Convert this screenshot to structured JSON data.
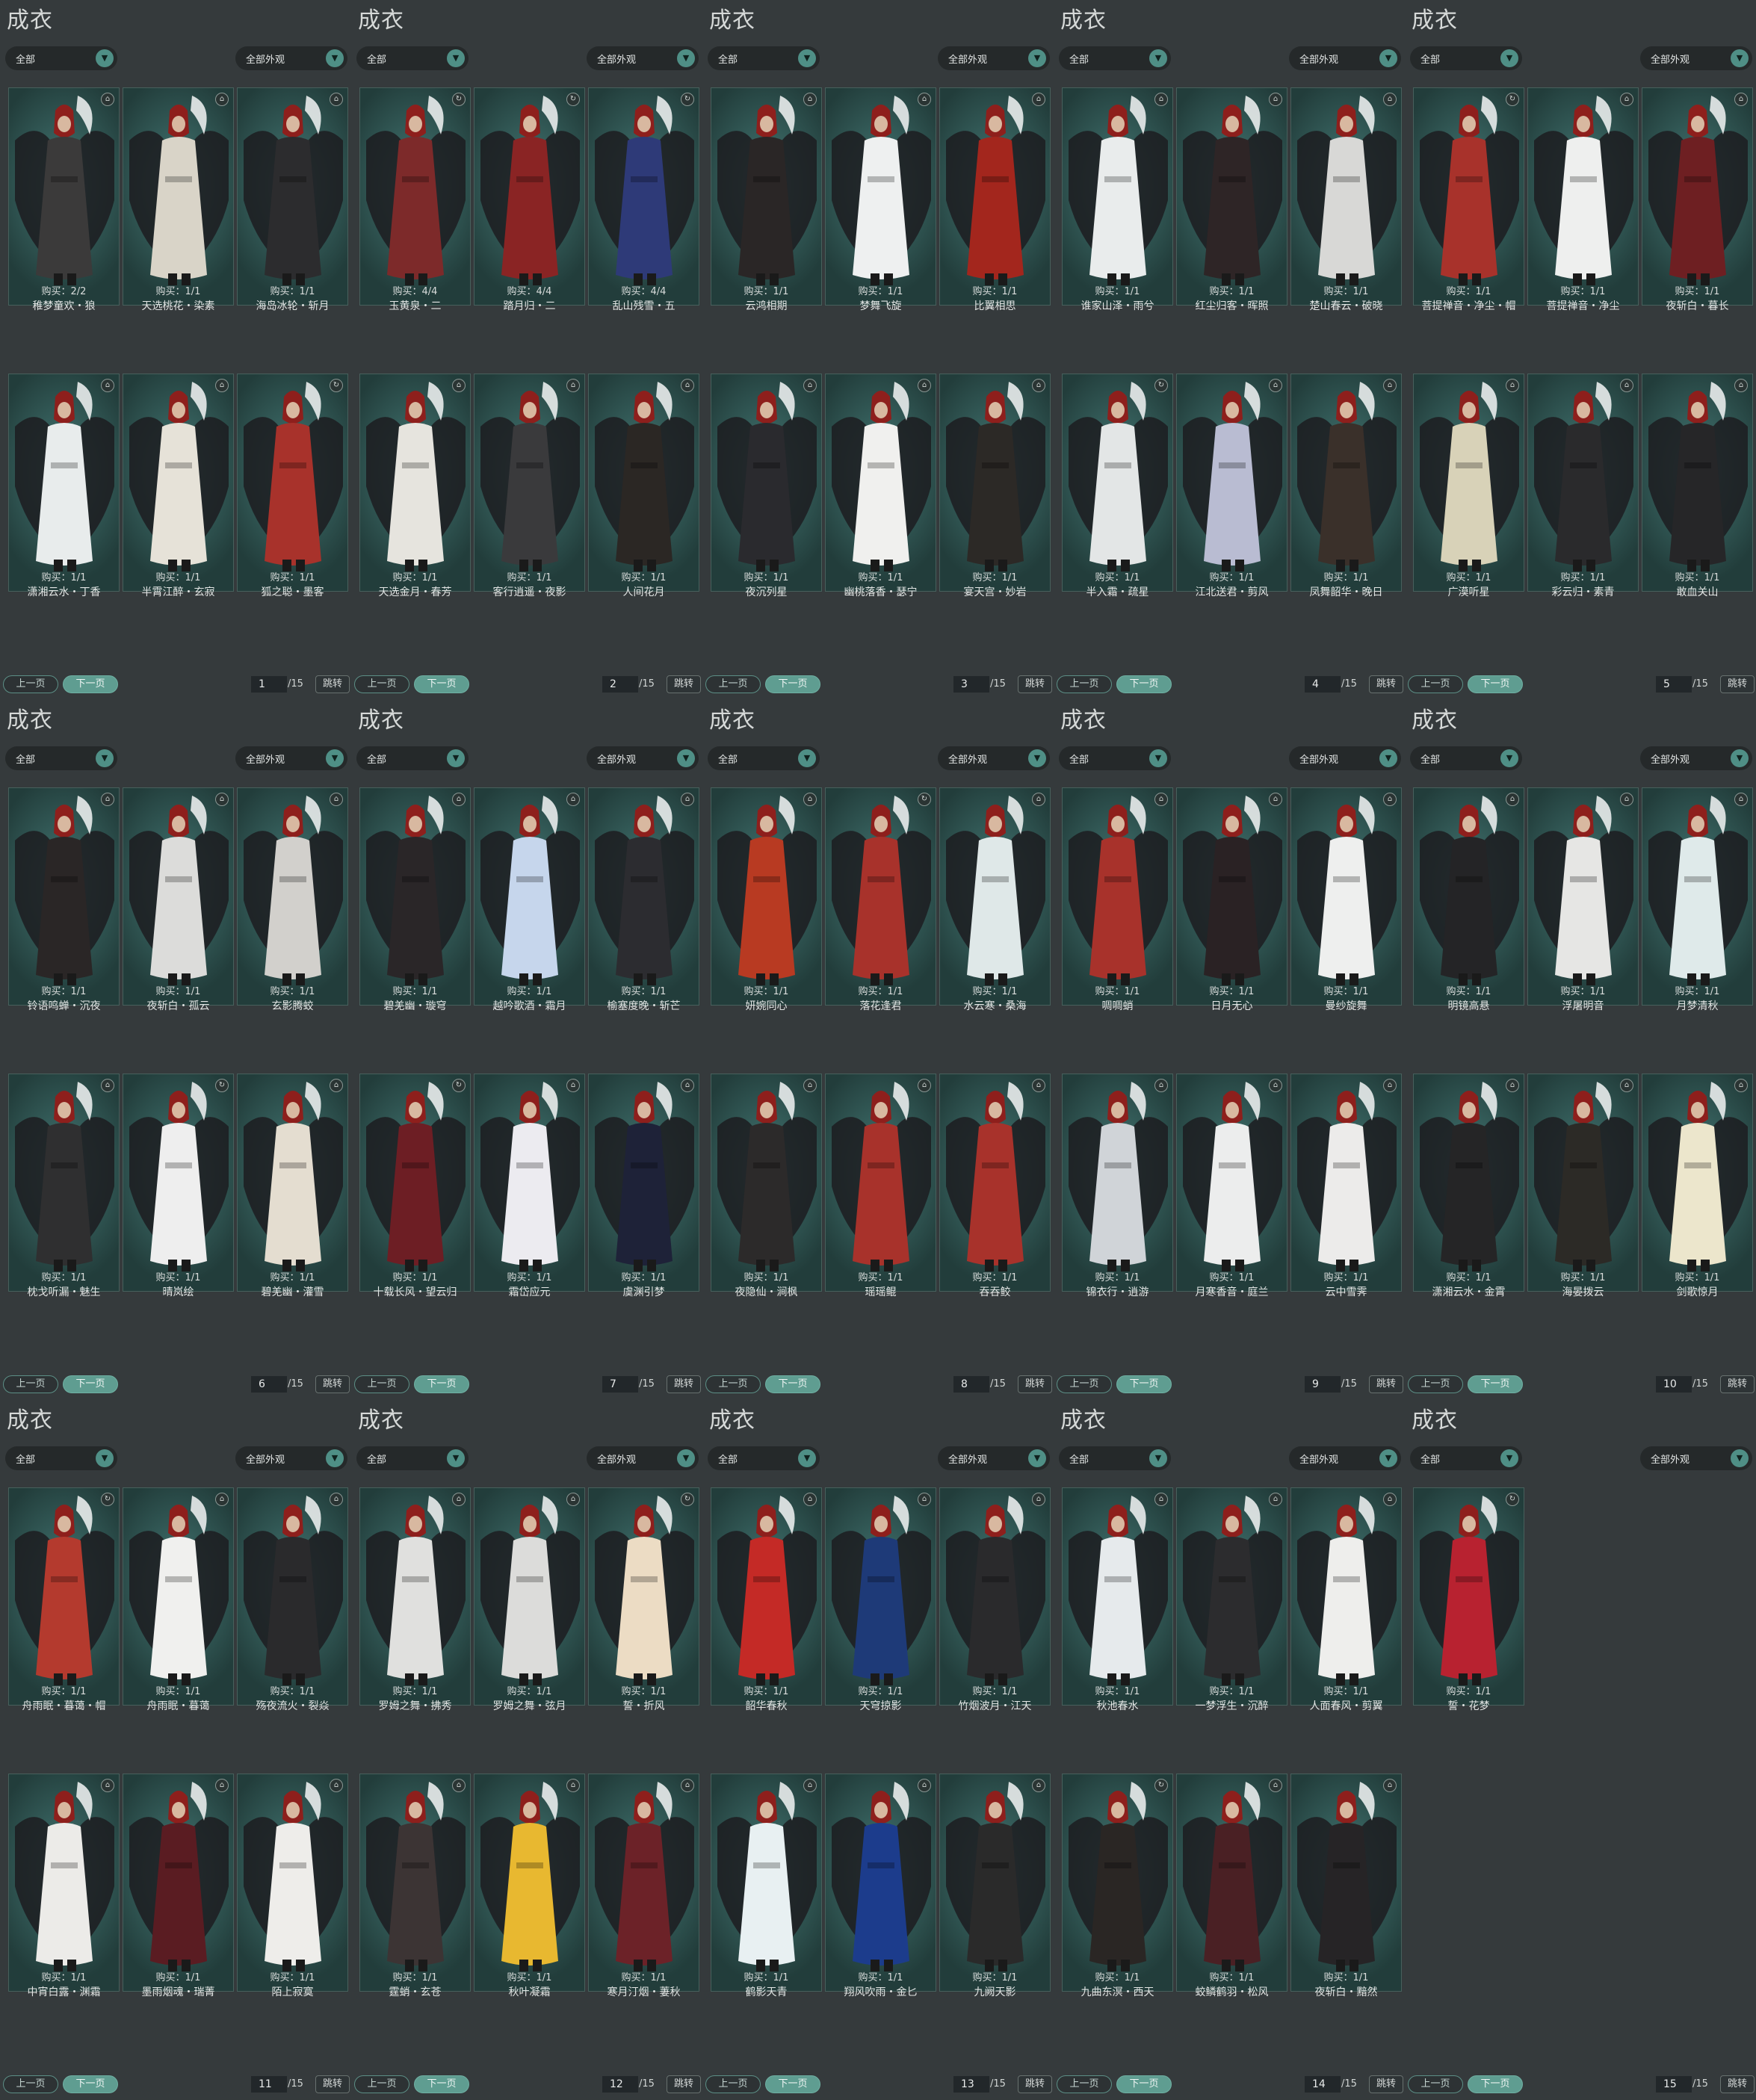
{
  "ui": {
    "title": "成衣",
    "filter_left": "全部",
    "filter_right": "全部外观",
    "prev": "上一页",
    "next": "下一页",
    "jump": "跳转",
    "total": "/15",
    "dropdown_icon": "chevron-down-icon"
  },
  "colors": {
    "accent": "#5f9d91",
    "background": "#34393b",
    "card": "#355e5b"
  },
  "panels": [
    {
      "page": "1",
      "items": [
        {
          "n": "稚梦童欢・狼",
          "b": "购买：2/2",
          "i": "trash-icon",
          "c": "#3b3a3a"
        },
        {
          "n": "天选桃花・染素",
          "b": "购买：1/1",
          "i": "trash-icon",
          "c": "#d9d4c8"
        },
        {
          "n": "海岛冰轮・斩月",
          "b": "购买：1/1",
          "i": "trash-icon",
          "c": "#2c2c2e"
        },
        {
          "n": "潇湘云水・丁香",
          "b": "购买：1/1",
          "i": "trash-icon",
          "c": "#e8ecec"
        },
        {
          "n": "半霄江醉・玄寂",
          "b": "购买：1/1",
          "i": "trash-icon",
          "c": "#e6e2d8"
        },
        {
          "n": "狐之聪・墨客",
          "b": "购买：1/1",
          "i": "refresh-icon",
          "c": "#a8322b"
        }
      ]
    },
    {
      "page": "2",
      "items": [
        {
          "n": "玉黄泉・二",
          "b": "购买：4/4",
          "i": "refresh-icon",
          "c": "#7d2a2a"
        },
        {
          "n": "踏月归・二",
          "b": "购买：4/4",
          "i": "refresh-icon",
          "c": "#8a2424"
        },
        {
          "n": "乱山残雪・五",
          "b": "购买：4/4",
          "i": "refresh-icon",
          "c": "#2e3a78"
        },
        {
          "n": "天选金月・春芳",
          "b": "购买：1/1",
          "i": "trash-icon",
          "c": "#e6e4de"
        },
        {
          "n": "客行逍遥・夜影",
          "b": "购买：1/1",
          "i": "trash-icon",
          "c": "#3a3a3c"
        },
        {
          "n": "人间花月",
          "b": "购买：1/1",
          "i": "trash-icon",
          "c": "#2b2724"
        }
      ]
    },
    {
      "page": "3",
      "items": [
        {
          "n": "云鸿相期",
          "b": "购买：1/1",
          "i": "trash-icon",
          "c": "#2a2626"
        },
        {
          "n": "梦舞飞旋",
          "b": "购买：1/1",
          "i": "trash-icon",
          "c": "#eef0f0"
        },
        {
          "n": "比翼相思",
          "b": "购买：1/1",
          "i": "trash-icon",
          "c": "#a3261d"
        },
        {
          "n": "夜沉列星",
          "b": "购买：1/1",
          "i": "trash-icon",
          "c": "#2a2a2e"
        },
        {
          "n": "幽桃落香・瑟宁",
          "b": "购买：1/1",
          "i": "trash-icon",
          "c": "#f0f0ee"
        },
        {
          "n": "宴天宫・妙岩",
          "b": "购买：1/1",
          "i": "trash-icon",
          "c": "#2c2926"
        }
      ]
    },
    {
      "page": "4",
      "items": [
        {
          "n": "谁家山泽・雨兮",
          "b": "购买：1/1",
          "i": "trash-icon",
          "c": "#e9ecec"
        },
        {
          "n": "红尘归客・晖照",
          "b": "购买：1/1",
          "i": "trash-icon",
          "c": "#2e2526"
        },
        {
          "n": "楚山春云・破晓",
          "b": "购买：1/1",
          "i": "trash-icon",
          "c": "#d8d8d6"
        },
        {
          "n": "半入霜・疏星",
          "b": "购买：1/1",
          "i": "refresh-icon",
          "c": "#e3e6e6"
        },
        {
          "n": "江北送君・剪风",
          "b": "购买：1/1",
          "i": "trash-icon",
          "c": "#b9bcd2"
        },
        {
          "n": "凤舞韶华・晚日",
          "b": "购买：1/1",
          "i": "trash-icon",
          "c": "#3a302a"
        }
      ]
    },
    {
      "page": "5",
      "items": [
        {
          "n": "菩提禅音・净尘・帽",
          "b": "购买：1/1",
          "i": "refresh-icon",
          "c": "#a8322b"
        },
        {
          "n": "菩提禅音・净尘",
          "b": "购买：1/1",
          "i": "trash-icon",
          "c": "#eeefee"
        },
        {
          "n": "夜斩白・暮长",
          "b": "购买：1/1",
          "i": "trash-icon",
          "c": "#6e1f22"
        },
        {
          "n": "广漠听星",
          "b": "购买：1/1",
          "i": "trash-icon",
          "c": "#d8d2b8"
        },
        {
          "n": "彩云归・素青",
          "b": "购买：1/1",
          "i": "trash-icon",
          "c": "#2a2a2c"
        },
        {
          "n": "敢血关山",
          "b": "购买：1/1",
          "i": "trash-icon",
          "c": "#262628"
        }
      ]
    },
    {
      "page": "6",
      "items": [
        {
          "n": "铃语鸣蝉・沉夜",
          "b": "购买：1/1",
          "i": "trash-icon",
          "c": "#2a2626"
        },
        {
          "n": "夜斩白・孤云",
          "b": "购买：1/1",
          "i": "trash-icon",
          "c": "#dcdcda"
        },
        {
          "n": "玄影腾蛟",
          "b": "购买：1/1",
          "i": "trash-icon",
          "c": "#d2d0cc"
        },
        {
          "n": "枕戈听漏・魅生",
          "b": "购买：1/1",
          "i": "trash-icon",
          "c": "#2f2f30"
        },
        {
          "n": "晴岚绘",
          "b": "购买：1/1",
          "i": "refresh-icon",
          "c": "#eeeeee"
        },
        {
          "n": "碧羌幽・灌雪",
          "b": "购买：1/1",
          "i": "trash-icon",
          "c": "#e4ddd0"
        }
      ]
    },
    {
      "page": "7",
      "items": [
        {
          "n": "碧羌幽・璇穹",
          "b": "购买：1/1",
          "i": "trash-icon",
          "c": "#2a2628"
        },
        {
          "n": "越吟歌酒・霜月",
          "b": "购买：1/1",
          "i": "trash-icon",
          "c": "#c6d6ec"
        },
        {
          "n": "榆塞度晚・斩芒",
          "b": "购买：1/1",
          "i": "trash-icon",
          "c": "#2c2c30"
        },
        {
          "n": "十载长风・望云归",
          "b": "购买：1/1",
          "i": "refresh-icon",
          "c": "#6d1e24"
        },
        {
          "n": "霜岱应元",
          "b": "购买：1/1",
          "i": "trash-icon",
          "c": "#ecebf0"
        },
        {
          "n": "虞渊引梦",
          "b": "购买：1/1",
          "i": "trash-icon",
          "c": "#1e2238"
        }
      ]
    },
    {
      "page": "8",
      "items": [
        {
          "n": "妍婉同心",
          "b": "购买：1/1",
          "i": "trash-icon",
          "c": "#b83a22"
        },
        {
          "n": "落花逢君",
          "b": "购买：1/1",
          "i": "refresh-icon",
          "c": "#a8322b"
        },
        {
          "n": "水云寒・桑海",
          "b": "购买：1/1",
          "i": "trash-icon",
          "c": "#dfe8e8"
        },
        {
          "n": "夜隐仙・涧枫",
          "b": "购买：1/1",
          "i": "trash-icon",
          "c": "#2c2a2a"
        },
        {
          "n": "瑶瑶鲲",
          "b": "购买：1/1",
          "i": "trash-icon",
          "c": "#a8322b"
        },
        {
          "n": "吞吞鲛",
          "b": "购买：1/1",
          "i": "trash-icon",
          "c": "#a8322b"
        }
      ]
    },
    {
      "page": "9",
      "items": [
        {
          "n": "啁啁蛸",
          "b": "购买：1/1",
          "i": "trash-icon",
          "c": "#a8322b"
        },
        {
          "n": "日月无心",
          "b": "购买：1/1",
          "i": "trash-icon",
          "c": "#2a2224"
        },
        {
          "n": "曼纱旋舞",
          "b": "购买：1/1",
          "i": "trash-icon",
          "c": "#eeefee"
        },
        {
          "n": "锦衣行・逍游",
          "b": "购买：1/1",
          "i": "trash-icon",
          "c": "#d0d4d8"
        },
        {
          "n": "月寒香音・庭兰",
          "b": "购买：1/1",
          "i": "trash-icon",
          "c": "#eceded"
        },
        {
          "n": "云中雪霁",
          "b": "购买：1/1",
          "i": "trash-icon",
          "c": "#ecebea"
        }
      ]
    },
    {
      "page": "10",
      "items": [
        {
          "n": "明镜高悬",
          "b": "购买：1/1",
          "i": "trash-icon",
          "c": "#242426"
        },
        {
          "n": "浮屠明音",
          "b": "购买：1/1",
          "i": "trash-icon",
          "c": "#e6e6e4"
        },
        {
          "n": "月梦清秋",
          "b": "购买：1/1",
          "i": "trash-icon",
          "c": "#dfeaea"
        },
        {
          "n": "潇湘云水・金霄",
          "b": "购买：1/1",
          "i": "trash-icon",
          "c": "#252526"
        },
        {
          "n": "海晏拨云",
          "b": "购买：1/1",
          "i": "trash-icon",
          "c": "#2c2a26"
        },
        {
          "n": "剑歌惊月",
          "b": "购买：1/1",
          "i": "trash-icon",
          "c": "#ece6cc"
        }
      ]
    },
    {
      "page": "11",
      "items": [
        {
          "n": "舟雨眠・暮蔼・帽",
          "b": "购买：1/1",
          "i": "refresh-icon",
          "c": "#b43a2e"
        },
        {
          "n": "舟雨眠・暮蔼",
          "b": "购买：1/1",
          "i": "trash-icon",
          "c": "#f0f0ee"
        },
        {
          "n": "殇夜流火・裂焱",
          "b": "购买：1/1",
          "i": "trash-icon",
          "c": "#2a2a2c"
        },
        {
          "n": "中宵白露・渊霜",
          "b": "购买：1/1",
          "i": "trash-icon",
          "c": "#ecebe8"
        },
        {
          "n": "墨雨烟魂・瑞菁",
          "b": "购买：1/1",
          "i": "trash-icon",
          "c": "#5a1c22"
        },
        {
          "n": "陌上寂寞",
          "b": "购买：1/1",
          "i": "trash-icon",
          "c": "#eeedea"
        }
      ]
    },
    {
      "page": "12",
      "items": [
        {
          "n": "罗姆之舞・拂秀",
          "b": "购买：1/1",
          "i": "trash-icon",
          "c": "#e0e0de"
        },
        {
          "n": "罗姆之舞・弦月",
          "b": "购买：1/1",
          "i": "trash-icon",
          "c": "#dcdcda"
        },
        {
          "n": "誓・折风",
          "b": "购买：1/1",
          "i": "refresh-icon",
          "c": "#ecdcc4"
        },
        {
          "n": "霆蛸・玄苍",
          "b": "购买：1/1",
          "i": "trash-icon",
          "c": "#3c3434"
        },
        {
          "n": "秋叶凝霜",
          "b": "购买：1/1",
          "i": "trash-icon",
          "c": "#e8b830"
        },
        {
          "n": "寒月汀烟・萋秋",
          "b": "购买：1/1",
          "i": "trash-icon",
          "c": "#6c2228"
        }
      ]
    },
    {
      "page": "13",
      "items": [
        {
          "n": "韶华春秋",
          "b": "购买：1/1",
          "i": "trash-icon",
          "c": "#c42a26"
        },
        {
          "n": "天穹掠影",
          "b": "购买：1/1",
          "i": "trash-icon",
          "c": "#1e3a78"
        },
        {
          "n": "竹烟波月・江天",
          "b": "购买：1/1",
          "i": "trash-icon",
          "c": "#2a2a2c"
        },
        {
          "n": "鹤影天青",
          "b": "购买：1/1",
          "i": "trash-icon",
          "c": "#e8f0f2"
        },
        {
          "n": "翔风吹雨・金匕",
          "b": "购买：1/1",
          "i": "trash-icon",
          "c": "#1c3c8c"
        },
        {
          "n": "九阙天影",
          "b": "购买：1/1",
          "i": "trash-icon",
          "c": "#2a2a2a"
        }
      ]
    },
    {
      "page": "14",
      "items": [
        {
          "n": "秋池春水",
          "b": "购买：1/1",
          "i": "trash-icon",
          "c": "#e6eaec"
        },
        {
          "n": "一梦浮生・沉醉",
          "b": "购买：1/1",
          "i": "trash-icon",
          "c": "#2c2c2e"
        },
        {
          "n": "人面春风・剪翼",
          "b": "购买：1/1",
          "i": "trash-icon",
          "c": "#eeeeec"
        },
        {
          "n": "九曲东溟・西天",
          "b": "购买：1/1",
          "i": "refresh-icon",
          "c": "#2a2624"
        },
        {
          "n": "蛟鳞鹤羽・松风",
          "b": "购买：1/1",
          "i": "trash-icon",
          "c": "#4a2024"
        },
        {
          "n": "夜斩白・黯然",
          "b": "购买：1/1",
          "i": "trash-icon",
          "c": "#262426"
        }
      ]
    },
    {
      "page": "15",
      "items": [
        {
          "n": "誓・花梦",
          "b": "购买：1/1",
          "i": "refresh-icon",
          "c": "#b82230"
        }
      ]
    }
  ]
}
